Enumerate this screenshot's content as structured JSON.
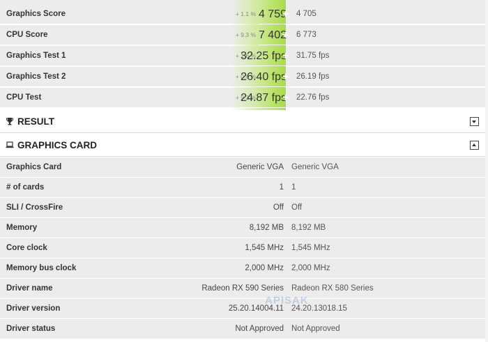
{
  "scores": [
    {
      "label": "Graphics Score",
      "delta": "+ 1.1 %",
      "value": "4 759",
      "compare": "4 705"
    },
    {
      "label": "CPU Score",
      "delta": "+ 9.3 %",
      "value": "7 402",
      "compare": "6 773"
    },
    {
      "label": "Graphics Test 1",
      "delta": "+ 1.6 %",
      "value": "32.25 fps",
      "compare": "31.75 fps"
    },
    {
      "label": "Graphics Test 2",
      "delta": "+ 0.8 %",
      "value": "26.40 fps",
      "compare": "26.19 fps"
    },
    {
      "label": "CPU Test",
      "delta": "+ 9.3 %",
      "value": "24.87 fps",
      "compare": "22.76 fps"
    }
  ],
  "result_section": {
    "title": "RESULT",
    "icon": "trophy-icon",
    "state": "collapsed"
  },
  "graphics_section": {
    "title": "GRAPHICS CARD",
    "icon": "laptop-icon",
    "state": "expanded"
  },
  "graphics_card": [
    {
      "label": "Graphics Card",
      "value": "Generic VGA",
      "compare": "Generic VGA"
    },
    {
      "label": "# of cards",
      "value": "1",
      "compare": "1"
    },
    {
      "label": "SLI / CrossFire",
      "value": "Off",
      "compare": "Off"
    },
    {
      "label": "Memory",
      "value": "8,192 MB",
      "compare": "8,192 MB"
    },
    {
      "label": "Core clock",
      "value": "1,545 MHz",
      "compare": "1,545 MHz"
    },
    {
      "label": "Memory bus clock",
      "value": "2,000 MHz",
      "compare": "2,000 MHz"
    },
    {
      "label": "Driver name",
      "value": "Radeon RX 590 Series",
      "compare": "Radeon RX 580 Series"
    },
    {
      "label": "Driver version",
      "value": "25.20.14004.11",
      "compare": "24.20.13018.15"
    },
    {
      "label": "Driver status",
      "value": "Not Approved",
      "compare": "Not Approved"
    }
  ],
  "watermark": "APISAK",
  "colors": {
    "bar": "#a8db4a",
    "row_bg": "#ececec"
  }
}
